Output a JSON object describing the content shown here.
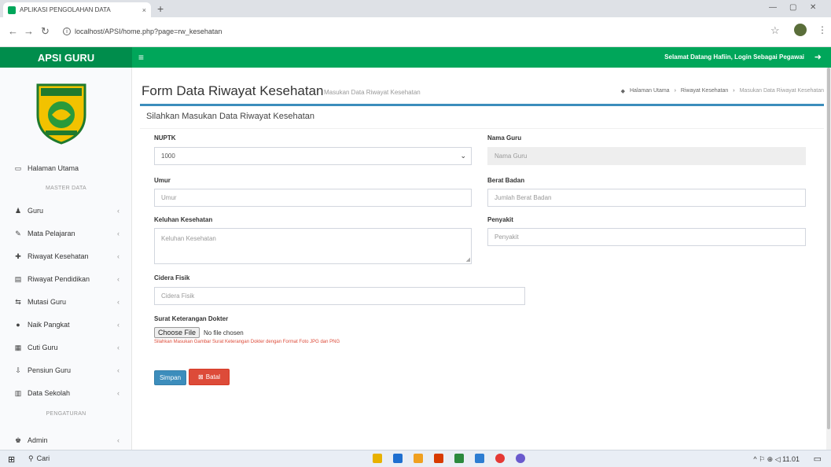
{
  "browser": {
    "tab_title": "APLIKASI PENGOLAHAN DATA",
    "tab_close": "×",
    "new_tab": "+",
    "url": "localhost/APSI/home.php?page=rw_kesehatan",
    "minimize": "—",
    "maximize": "▢",
    "close": "✕"
  },
  "header": {
    "logo": "APSI GURU",
    "menu_icon": "≡",
    "welcome": "Selamat Datang Hafiin, Login Sebagai Pegawai",
    "logout_icon": "➜"
  },
  "sidebar": {
    "items": [
      {
        "label": "Halaman Utama",
        "icon": "▭",
        "chevron": ""
      },
      {
        "label": "Guru",
        "icon": "♟",
        "chevron": "‹"
      },
      {
        "label": "Mata Pelajaran",
        "icon": "✎",
        "chevron": "‹"
      },
      {
        "label": "Riwayat Kesehatan",
        "icon": "✚",
        "chevron": "‹"
      },
      {
        "label": "Riwayat Pendidikan",
        "icon": "▤",
        "chevron": "‹"
      },
      {
        "label": "Mutasi Guru",
        "icon": "⇆",
        "chevron": "‹"
      },
      {
        "label": "Naik Pangkat",
        "icon": "●",
        "chevron": "‹"
      },
      {
        "label": "Cuti Guru",
        "icon": "▦",
        "chevron": "‹"
      },
      {
        "label": "Pensiun Guru",
        "icon": "⇩",
        "chevron": "‹"
      },
      {
        "label": "Data Sekolah",
        "icon": "▥",
        "chevron": "‹"
      },
      {
        "label": "Admin",
        "icon": "♚",
        "chevron": "‹"
      }
    ],
    "section_master": "MASTER DATA",
    "section_pengaturan": "PENGATURAN"
  },
  "page": {
    "title": "Form Data Riwayat Kesehatan",
    "subtitle": "Masukan Data Riwayat Kesehatan",
    "breadcrumb": [
      "Halaman Utama",
      "Riwayat Kesehatan",
      "Masukan Data Riwayat Kesehatan"
    ],
    "box_title": "Silahkan Masukan Data Riwayat Kesehatan"
  },
  "form": {
    "nuptk_label": "NUPTK",
    "nuptk_value": "1000",
    "nama_label": "Nama Guru",
    "nama_placeholder": "Nama Guru",
    "umur_label": "Umur",
    "umur_placeholder": "Umur",
    "berat_label": "Berat Badan",
    "berat_placeholder": "Jumlah Berat Badan",
    "keluhan_label": "Keluhan Kesehatan",
    "keluhan_placeholder": "Keluhan Kesehatan",
    "penyakit_label": "Penyakit",
    "penyakit_placeholder": "Penyakit",
    "cidera_label": "Cidera Fisik",
    "cidera_placeholder": "Cidera Fisik",
    "surat_label": "Surat Keterangan Dokter",
    "file_button": "Choose File",
    "file_status": "No file chosen",
    "help_text": "Silahkan Masukan Gambar Surat Keterangan Dokter dengan Format Foto JPG dan PNG",
    "save_label": "Simpan",
    "reset_label": "Batal"
  },
  "taskbar": {
    "search": "Cari",
    "tray": "^ ⚐ ⊕ ◁ 11.01"
  }
}
